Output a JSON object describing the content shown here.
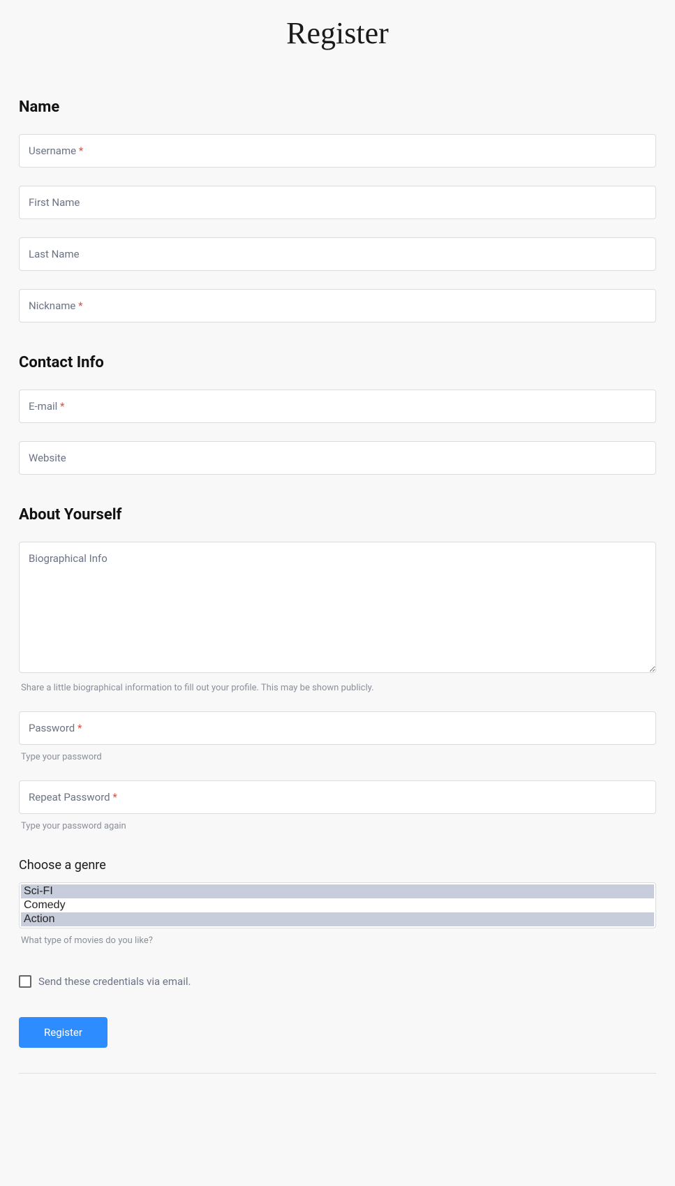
{
  "title": "Register",
  "sections": {
    "name": "Name",
    "contact": "Contact Info",
    "about": "About Yourself"
  },
  "fields": {
    "username": {
      "label": "Username",
      "required": true
    },
    "first_name": {
      "label": "First Name",
      "required": false
    },
    "last_name": {
      "label": "Last Name",
      "required": false
    },
    "nickname": {
      "label": "Nickname",
      "required": true
    },
    "email": {
      "label": "E-mail",
      "required": true
    },
    "website": {
      "label": "Website",
      "required": false
    },
    "bio": {
      "label": "Biographical Info",
      "required": false,
      "help": "Share a little biographical information to fill out your profile. This may be shown publicly."
    },
    "password": {
      "label": "Password",
      "required": true,
      "help": "Type your password"
    },
    "repeat_password": {
      "label": "Repeat Password",
      "required": true,
      "help": "Type your password again"
    }
  },
  "genre": {
    "label": "Choose a genre",
    "options": [
      "Sci-FI",
      "Comedy",
      "Action"
    ],
    "selected": [
      0,
      2
    ],
    "help": "What type of movies do you like?"
  },
  "send_credentials": {
    "label": "Send these credentials via email.",
    "checked": false
  },
  "submit": {
    "label": "Register"
  },
  "asterisk": "*"
}
